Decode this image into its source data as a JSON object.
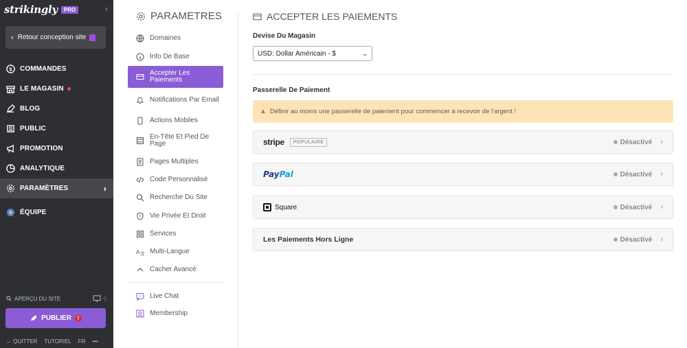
{
  "sidebar": {
    "brand": "strikingly",
    "pro_badge": "PRO",
    "back_label": "Retour conception site",
    "items": [
      {
        "label": "COMMANDES",
        "icon": "dollar-icon"
      },
      {
        "label": "LE MAGASIN",
        "icon": "store-icon"
      },
      {
        "label": "BLOG",
        "icon": "pen-icon"
      },
      {
        "label": "PUBLIC",
        "icon": "users-icon"
      },
      {
        "label": "PROMOTION",
        "icon": "megaphone-icon"
      },
      {
        "label": "ANALYTIQUE",
        "icon": "analytics-icon"
      },
      {
        "label": "PARAMÈTRES",
        "icon": "gear-icon"
      },
      {
        "label": "ÉQUIPE",
        "icon": "team-icon"
      }
    ],
    "preview_label": "APERÇU DU SITE",
    "preview_count": "0",
    "publish_label": "PUBLIER",
    "publish_warning": "!",
    "footer": {
      "quit": "QUITTER",
      "tutorial": "TUTORIEL",
      "lang": "FR",
      "more": "•••"
    }
  },
  "settings_menu": {
    "title": "PARAMETRES",
    "items": [
      {
        "label": "Domaines",
        "icon": "globe-icon"
      },
      {
        "label": "Info De Base",
        "icon": "info-icon"
      },
      {
        "label": "Accepter Les Paiements",
        "icon": "card-icon"
      },
      {
        "label": "Notifications Par Email",
        "icon": "bell-icon"
      },
      {
        "label": "Actions Mobiles",
        "icon": "mobile-icon"
      },
      {
        "label": "En-Tête Et Pied De Page",
        "icon": "layout-icon"
      },
      {
        "label": "Pages Multiples",
        "icon": "pages-icon"
      },
      {
        "label": "Code Personnalisé",
        "icon": "code-icon"
      },
      {
        "label": "Recherche Du Site",
        "icon": "search-icon"
      },
      {
        "label": "Vie Privée Et Droit",
        "icon": "shield-icon"
      },
      {
        "label": "Services",
        "icon": "grid-icon"
      },
      {
        "label": "Multi-Langue",
        "icon": "translate-icon"
      },
      {
        "label": "Cacher Avancé",
        "icon": "chevron-up-icon"
      },
      {
        "label": "Live Chat",
        "icon": "chat-icon"
      },
      {
        "label": "Membership",
        "icon": "member-icon"
      }
    ]
  },
  "main": {
    "title": "ACCEPTER LES PAIEMENTS",
    "currency_label": "Devise Du Magasin",
    "currency_value": "USD: Dollar Américain - $",
    "gateway_label": "Passerelle De Paiement",
    "alert": "Définir au moins une passerelle de paiement pour commencer à recevoir de l'argent !",
    "gateways": [
      {
        "name": "stripe",
        "badge": "POPULAIRE",
        "status": "Désactivé"
      },
      {
        "name_pay": "Pay",
        "name_pal": "Pal",
        "status": "Désactivé"
      },
      {
        "name": "Square",
        "status": "Désactivé"
      },
      {
        "name": "Les Paiements Hors Ligne",
        "status": "Désactivé"
      }
    ]
  },
  "colors": {
    "sidebar_bg": "#2d2f33",
    "accent": "#8a5cd6",
    "alert_bg": "#fde4b8"
  }
}
